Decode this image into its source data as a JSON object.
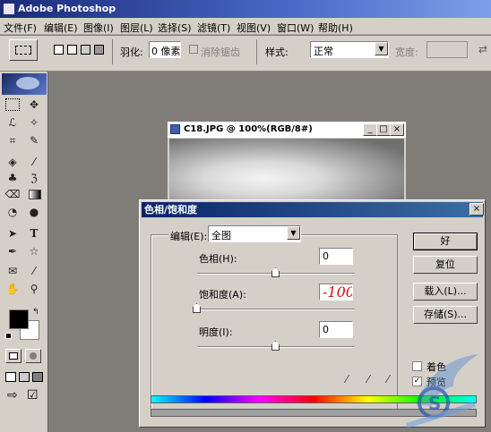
{
  "app": {
    "title": "Adobe Photoshop"
  },
  "menu": [
    "文件(F)",
    "编辑(E)",
    "图像(I)",
    "图层(L)",
    "选择(S)",
    "滤镜(T)",
    "视图(V)",
    "窗口(W)",
    "帮助(H)"
  ],
  "options": {
    "feather_label": "羽化:",
    "feather_value": "0 像素",
    "antialias_label": "消除锯齿",
    "style_label": "样式:",
    "style_value": "正常",
    "width_label": "宽度:"
  },
  "document": {
    "title": "C18.JPG @ 100%(RGB/8#)"
  },
  "dialog": {
    "title": "色相/饱和度",
    "edit_label": "编辑(E):",
    "edit_value": "全图",
    "hue_label": "色相(H):",
    "hue_value": "0",
    "saturation_label": "饱和度(A):",
    "saturation_value": "-100",
    "lightness_label": "明度(I):",
    "lightness_value": "0",
    "ok_label": "好",
    "reset_label": "复位",
    "load_label": "载入(L)...",
    "save_label": "存储(S)...",
    "colorize_label": "着色",
    "preview_label": "预览",
    "close_glyph": "×"
  },
  "slider_levels": {
    "hue": 0.5,
    "saturation": 0.0,
    "lightness": 0.5
  },
  "icons": [
    "app-icon",
    "close-icon",
    "minimize-icon",
    "maximize-icon",
    "eyedropper-icon",
    "eyedropper-plus-icon",
    "eyedropper-minus-icon",
    "dropdown-arrow-icon"
  ]
}
